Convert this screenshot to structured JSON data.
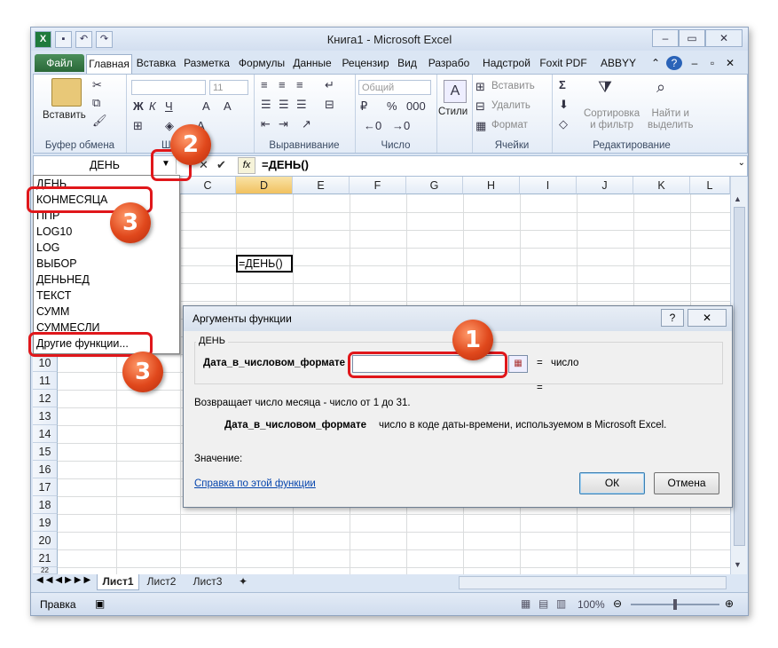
{
  "window": {
    "title": "Книга1  -  Microsoft Excel",
    "minimize": "‒",
    "restore": "▭",
    "close": "✕"
  },
  "quick_access": {
    "app_icon": "X",
    "save": "▪",
    "undo": "↶",
    "redo": "↷"
  },
  "tabs": [
    "Файл",
    "Главная",
    "Вставка",
    "Разметка",
    "Формулы",
    "Данные",
    "Рецензир",
    "Вид",
    "Разрабо",
    "Надстрой",
    "Foxit PDF",
    "ABBYY PDF"
  ],
  "ribbon": {
    "paste_label": "Вставить",
    "group_clipboard": "Буфер обмена",
    "group_font_short": "Ш",
    "font_size": "11",
    "group_alignment": "Выравнивание",
    "number_format": "Общий",
    "group_number": "Число",
    "styles_label": "Стили",
    "insert_cells": "Вставить",
    "delete_cells": "Удалить",
    "format_cells": "Формат",
    "group_cells": "Ячейки",
    "sum_symbol": "Σ",
    "sort_filter": "Сортировка\nи фильтр",
    "find_select": "Найти и\nвыделить",
    "group_editing": "Редактирование"
  },
  "formula_bar": {
    "name_box": "ДЕНЬ",
    "cancel": "✕",
    "enter": "✔",
    "fx": "fx",
    "formula": "=ДЕНЬ()"
  },
  "columns": [
    "C",
    "D",
    "E",
    "F",
    "G",
    "H",
    "I",
    "J",
    "K",
    "L"
  ],
  "rows": [
    "10",
    "11",
    "12",
    "13",
    "14",
    "15",
    "16",
    "17",
    "18",
    "19",
    "20",
    "21",
    "22"
  ],
  "active_cell_text": "=ДЕНЬ()",
  "function_dropdown": [
    "ДЕНЬ",
    "КОНМЕСЯЦА",
    "ППР",
    "LOG10",
    "LOG",
    "ВЫБОР",
    "ДЕНЬНЕД",
    "ТЕКСТ",
    "СУММ",
    "СУММЕСЛИ",
    "Другие функции..."
  ],
  "dialog": {
    "title": "Аргументы функции",
    "help_btn": "?",
    "close_btn": "✕",
    "function_name": "ДЕНЬ",
    "arg_label": "Дата_в_числовом_формате",
    "arg_value": "",
    "arg_result_eq": "=",
    "arg_result": "число",
    "total_eq": "=",
    "description": "Возвращает число месяца - число от 1 до 31.",
    "arg_desc_name": "Дата_в_числовом_формате",
    "arg_desc": "число в коде даты-времени, используемом в Microsoft Excel.",
    "value_label": "Значение:",
    "help_link": "Справка по этой функции",
    "ok": "ОК",
    "cancel": "Отмена"
  },
  "sheet_tabs": [
    "Лист1",
    "Лист2",
    "Лист3"
  ],
  "status": {
    "mode": "Правка",
    "zoom": "100%"
  },
  "annotations": [
    "1",
    "2",
    "3",
    "3"
  ],
  "colors": {
    "annotation_red": "#e0171b",
    "file_tab": "#2a6838",
    "selected_header": "#f1c15f"
  }
}
